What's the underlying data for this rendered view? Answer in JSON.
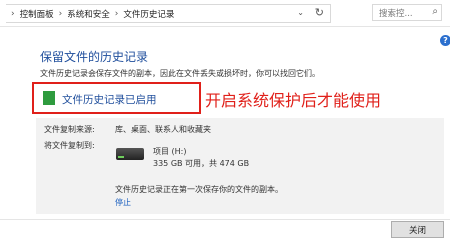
{
  "breadcrumb": {
    "items": [
      "控制面板",
      "系统和安全",
      "文件历史记录"
    ]
  },
  "search": {
    "placeholder": "搜索控..."
  },
  "help_label": "?",
  "page": {
    "title": "保留文件的历史记录",
    "description": "文件历史记录会保存文件的副本，因此在文件丢失或损坏时，你可以找回它们。"
  },
  "status": {
    "text": "文件历史记录已启用",
    "icon_color": "#2e9b3e"
  },
  "annotation": {
    "text": "开启系统保护后才能使用",
    "color": "#e0201a"
  },
  "details": {
    "source_label": "文件复制来源:",
    "source_value": "库、桌面、联系人和收藏夹",
    "target_label": "将文件复制到:",
    "drive_name": "项目 (H:)",
    "drive_space": "335 GB 可用，共 474 GB",
    "progress_text": "文件历史记录正在第一次保存你的文件的副本。",
    "stop_link": "停止"
  },
  "footer": {
    "close_label": "关闭"
  }
}
